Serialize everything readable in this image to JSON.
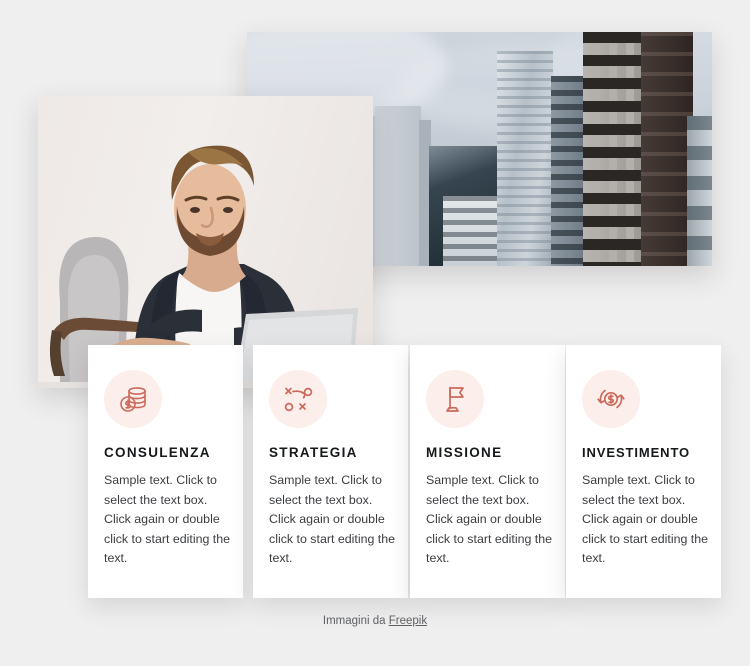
{
  "page": {
    "background_color": "#f0efef"
  },
  "media": [
    {
      "name": "city-skyline-photo",
      "alt": "Modern glass office skyscrapers under an overcast sky"
    },
    {
      "name": "businessman-photo",
      "alt": "Bearded businessman in a dark blazer working on a laptop in an armchair"
    }
  ],
  "cards": [
    {
      "icon": "coins-stack-icon",
      "title": "CONSULENZA",
      "body": "Sample text. Click to select the text box. Click again or double click to start editing the text."
    },
    {
      "icon": "strategy-playbook-icon",
      "title": "STRATEGIA",
      "body": "Sample text. Click to select the text box. Click again or double click to start editing the text."
    },
    {
      "icon": "flag-icon",
      "title": "MISSIONE",
      "body": "Sample text. Click to select the text box. Click again or double click to start editing the text."
    },
    {
      "icon": "money-refresh-icon",
      "title": "INVESTIMENTO",
      "body": "Sample text. Click to select the text box. Click again or double click to start editing the text."
    }
  ],
  "footer": {
    "prefix": "Immagini da ",
    "link_label": "Freepik"
  },
  "colors": {
    "accent": "#cd6a5c",
    "icon_badge_bg": "#fbeeeb",
    "card_bg": "#ffffff",
    "title_text": "#16181a",
    "body_text": "#3b3d40",
    "page_bg": "#f0efef"
  }
}
